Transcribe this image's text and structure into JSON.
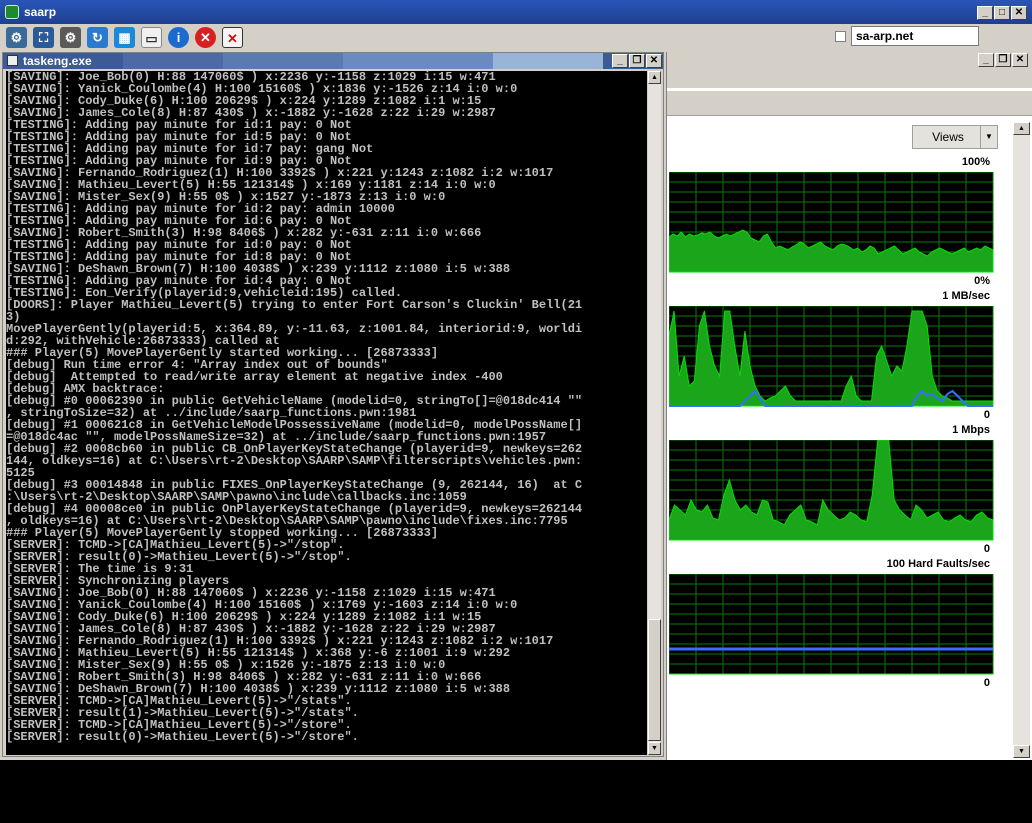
{
  "window": {
    "title": "saarp"
  },
  "toolbar": {
    "icons": [
      "connect-icon",
      "fullscreen-icon",
      "settings-icon",
      "refresh-icon",
      "windows-icon",
      "notepad-icon",
      "info-icon",
      "close-circle-icon",
      "document-x-icon"
    ],
    "address": "sa-arp.net"
  },
  "console": {
    "title": "taskeng.exe",
    "lines": [
      "[SAVING]: Joe_Bob(0) H:88 147060$ ) x:2236 y:-1158 z:1029 i:15 w:471",
      "[SAVING]: Yanick_Coulombe(4) H:100 15160$ ) x:1836 y:-1526 z:14 i:0 w:0",
      "[SAVING]: Cody_Duke(6) H:100 20629$ ) x:224 y:1289 z:1082 i:1 w:15",
      "[SAVING]: James_Cole(8) H:87 430$ ) x:-1882 y:-1628 z:22 i:29 w:2987",
      "[TESTING]: Adding pay minute for id:1 pay: 0 Not",
      "[TESTING]: Adding pay minute for id:5 pay: 0 Not",
      "[TESTING]: Adding pay minute for id:7 pay: gang Not",
      "[TESTING]: Adding pay minute for id:9 pay: 0 Not",
      "[SAVING]: Fernando_Rodriguez(1) H:100 3392$ ) x:221 y:1243 z:1082 i:2 w:1017",
      "[SAVING]: Mathieu_Levert(5) H:55 121314$ ) x:169 y:1181 z:14 i:0 w:0",
      "[SAVING]: Mister_Sex(9) H:55 0$ ) x:1527 y:-1873 z:13 i:0 w:0",
      "[TESTING]: Adding pay minute for id:2 pay: admin 10000",
      "[TESTING]: Adding pay minute for id:6 pay: 0 Not",
      "[SAVING]: Robert_Smith(3) H:98 8406$ ) x:282 y:-631 z:11 i:0 w:666",
      "[TESTING]: Adding pay minute for id:0 pay: 0 Not",
      "[TESTING]: Adding pay minute for id:8 pay: 0 Not",
      "[SAVING]: DeShawn_Brown(7) H:100 4038$ ) x:239 y:1112 z:1080 i:5 w:388",
      "[TESTING]: Adding pay minute for id:4 pay: 0 Not",
      "[TESTING]: Eon_Verify(playerid:9,vehicleid:195) called.",
      "[DOORS]: Player Mathieu_Levert(5) trying to enter Fort Carson's Cluckin' Bell(21",
      "3)",
      "MovePlayerGently(playerid:5, x:364.89, y:-11.63, z:1001.84, interiorid:9, worldi",
      "d:292, withVehicle:26873333) called at",
      "### Player(5) MovePlayerGently started working... [26873333]",
      "[debug] Run time error 4: \"Array index out of bounds\"",
      "[debug]  Attempted to read/write array element at negative index -400",
      "[debug] AMX backtrace:",
      "[debug] #0 00062390 in public GetVehicleName (modelid=0, stringTo[]=@018dc414 \"\"",
      ", stringToSize=32) at ../include/saarp_functions.pwn:1981",
      "[debug] #1 000621c8 in GetVehicleModelPossessiveName (modelid=0, modelPossName[]",
      "=@018dc4ac \"\", modelPossNameSize=32) at ../include/saarp_functions.pwn:1957",
      "[debug] #2 0008cb60 in public CB_OnPlayerKeyStateChange (playerid=9, newkeys=262",
      "144, oldkeys=16) at C:\\Users\\rt-2\\Desktop\\SAARP\\SAMP\\filterscripts\\vehicles.pwn:",
      "5125",
      "[debug] #3 00014848 in public FIXES_OnPlayerKeyStateChange (9, 262144, 16)  at C",
      ":\\Users\\rt-2\\Desktop\\SAARP\\SAMP\\pawno\\include\\callbacks.inc:1059",
      "[debug] #4 00008ce0 in public OnPlayerKeyStateChange (playerid=9, newkeys=262144",
      ", oldkeys=16) at C:\\Users\\rt-2\\Desktop\\SAARP\\SAMP\\pawno\\include\\fixes.inc:7795",
      "### Player(5) MovePlayerGently stopped working... [26873333]",
      "[SERVER]: TCMD->[CA]Mathieu_Levert(5)->\"/stop\".",
      "[SERVER]: result(0)->Mathieu_Levert(5)->\"/stop\".",
      "[SERVER]: The time is 9:31",
      "[SERVER]: Synchronizing players",
      "[SAVING]: Joe_Bob(0) H:88 147060$ ) x:2236 y:-1158 z:1029 i:15 w:471",
      "[SAVING]: Yanick_Coulombe(4) H:100 15160$ ) x:1769 y:-1603 z:14 i:0 w:0",
      "[SAVING]: Cody_Duke(6) H:100 20629$ ) x:224 y:1289 z:1082 i:1 w:15",
      "[SAVING]: James_Cole(8) H:87 430$ ) x:-1882 y:-1628 z:22 i:29 w:2987",
      "[SAVING]: Fernando_Rodriguez(1) H:100 3392$ ) x:221 y:1243 z:1082 i:2 w:1017",
      "[SAVING]: Mathieu_Levert(5) H:55 121314$ ) x:368 y:-6 z:1001 i:9 w:292",
      "[SAVING]: Mister_Sex(9) H:55 0$ ) x:1526 y:-1875 z:13 i:0 w:0",
      "[SAVING]: Robert_Smith(3) H:98 8406$ ) x:282 y:-631 z:11 i:0 w:666",
      "[SAVING]: DeShawn_Brown(7) H:100 4038$ ) x:239 y:1112 z:1080 i:5 w:388",
      "[SERVER]: TCMD->[CA]Mathieu_Levert(5)->\"/stats\".",
      "[SERVER]: result(1)->Mathieu_Levert(5)->\"/stats\".",
      "[SERVER]: TCMD->[CA]Mathieu_Levert(5)->\"/store\".",
      "[SERVER]: result(0)->Mathieu_Levert(5)->\"/store\"."
    ]
  },
  "monitor": {
    "views_label": "Views",
    "graphs": [
      {
        "name": "cpu",
        "top_label": "100%",
        "bottom_label": "0%",
        "values": [
          35,
          38,
          36,
          40,
          35,
          38,
          36,
          37,
          39,
          38,
          40,
          36,
          34,
          36,
          38,
          36,
          38,
          40,
          42,
          40,
          34,
          32,
          30,
          36,
          38,
          30,
          24,
          26,
          24,
          22,
          25,
          27,
          30,
          28,
          24,
          26,
          28,
          30,
          26,
          24,
          22,
          26,
          28,
          27,
          25,
          22,
          24,
          20,
          22,
          26,
          24,
          18,
          20,
          22,
          24,
          26,
          22,
          18,
          20,
          22,
          24,
          20,
          18,
          16,
          20,
          22,
          24,
          22,
          20,
          18,
          20,
          22,
          24,
          20,
          22,
          24,
          22,
          26,
          24,
          22
        ]
      },
      {
        "name": "disk",
        "top_label": "1 MB/sec",
        "bottom_label": "0",
        "values": [
          70,
          95,
          30,
          50,
          20,
          25,
          80,
          95,
          60,
          40,
          30,
          95,
          95,
          60,
          30,
          75,
          40,
          20,
          10,
          5,
          8,
          10,
          15,
          20,
          10,
          5,
          5,
          5,
          5,
          5,
          5,
          5,
          5,
          5,
          5,
          20,
          30,
          10,
          5,
          5,
          5,
          50,
          60,
          45,
          30,
          40,
          35,
          60,
          95,
          95,
          95,
          80,
          30,
          15,
          10,
          8,
          5,
          5,
          5,
          5,
          5,
          5,
          5,
          5,
          5
        ],
        "overlay": [
          0,
          0,
          0,
          0,
          0,
          0,
          0,
          0,
          0,
          0,
          0,
          0,
          0,
          0,
          0,
          5,
          10,
          15,
          8,
          0,
          0,
          0,
          0,
          0,
          0,
          0,
          0,
          0,
          0,
          0,
          0,
          0,
          0,
          0,
          0,
          0,
          0,
          0,
          0,
          0,
          0,
          0,
          0,
          0,
          0,
          0,
          0,
          0,
          0,
          10,
          15,
          10,
          12,
          8,
          5,
          12,
          15,
          10,
          5,
          0,
          0,
          0,
          0,
          0,
          0
        ]
      },
      {
        "name": "network",
        "top_label": "1 Mbps",
        "bottom_label": "0",
        "values": [
          20,
          35,
          30,
          25,
          40,
          30,
          28,
          35,
          22,
          20,
          45,
          60,
          40,
          30,
          35,
          28,
          25,
          40,
          38,
          20,
          18,
          15,
          25,
          30,
          35,
          20,
          18,
          15,
          40,
          30,
          25,
          20,
          22,
          28,
          25,
          20,
          18,
          45,
          100,
          100,
          100,
          40,
          30,
          25,
          20,
          35,
          30,
          22,
          25,
          28,
          20,
          18,
          22,
          25,
          20,
          18,
          25,
          28,
          22,
          20
        ]
      },
      {
        "name": "memory",
        "top_label": "100 Hard Faults/sec",
        "bottom_label": "0",
        "values": [
          0,
          0,
          0,
          0,
          0,
          0,
          0,
          0,
          0,
          0,
          0,
          0,
          0,
          0,
          0,
          0,
          0,
          0,
          0,
          0,
          0,
          0,
          0,
          0,
          0,
          0,
          0,
          0,
          0,
          0,
          0,
          0,
          0,
          0,
          0,
          0,
          0,
          0,
          0,
          0
        ],
        "overlay_level": 25
      }
    ]
  },
  "colors": {
    "graph_fill": "#1aa51a",
    "graph_line": "#00e000",
    "graph_bg": "#000000",
    "grid": "#0a7a0a",
    "overlay": "#3a6cff"
  }
}
